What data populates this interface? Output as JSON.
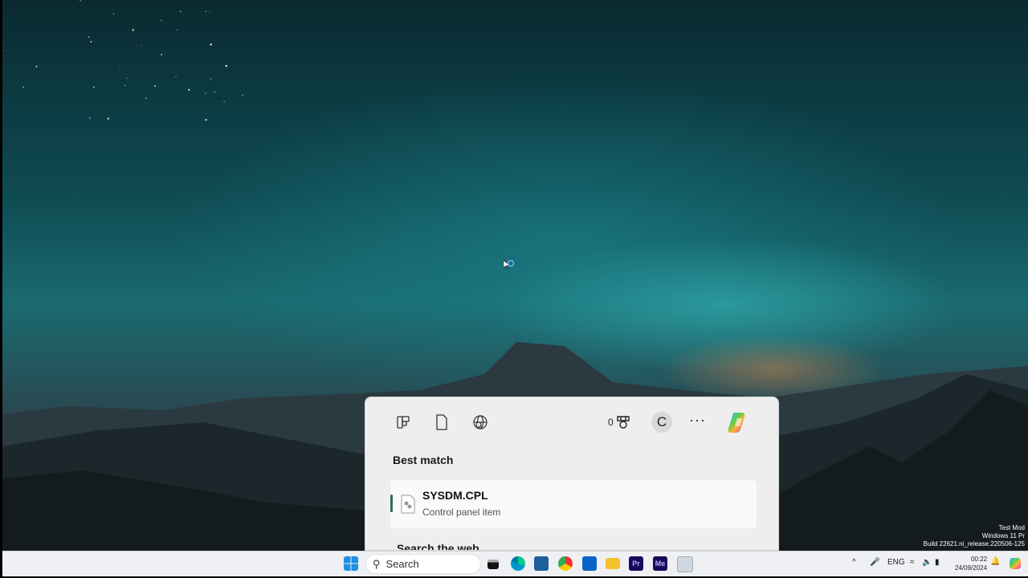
{
  "watermark": {
    "line1": "Test Mod",
    "line2": "Windows 11 Pr",
    "line3": "Build 22621.ni_release.220506-125"
  },
  "search_panel": {
    "points": "0",
    "avatar_initial": "C",
    "more_label": "···",
    "best_match_heading": "Best match",
    "best_match": {
      "title": "SYSDM.CPL",
      "subtitle": "Control panel item"
    },
    "search_web_heading": "Search the web"
  },
  "taskbar": {
    "search_label": "Search",
    "apps": [
      "start",
      "task-view",
      "edge",
      "store",
      "chrome",
      "outlook",
      "file-explorer",
      "premiere-pro",
      "media-encoder",
      "remote-desktop"
    ],
    "tray": {
      "language": "ENG",
      "time": "00:22",
      "date": "24/09/2024"
    }
  },
  "colors": {
    "accent": "#2e6b55",
    "panel": "#eeeeee",
    "taskbar": "#eef0f3"
  }
}
